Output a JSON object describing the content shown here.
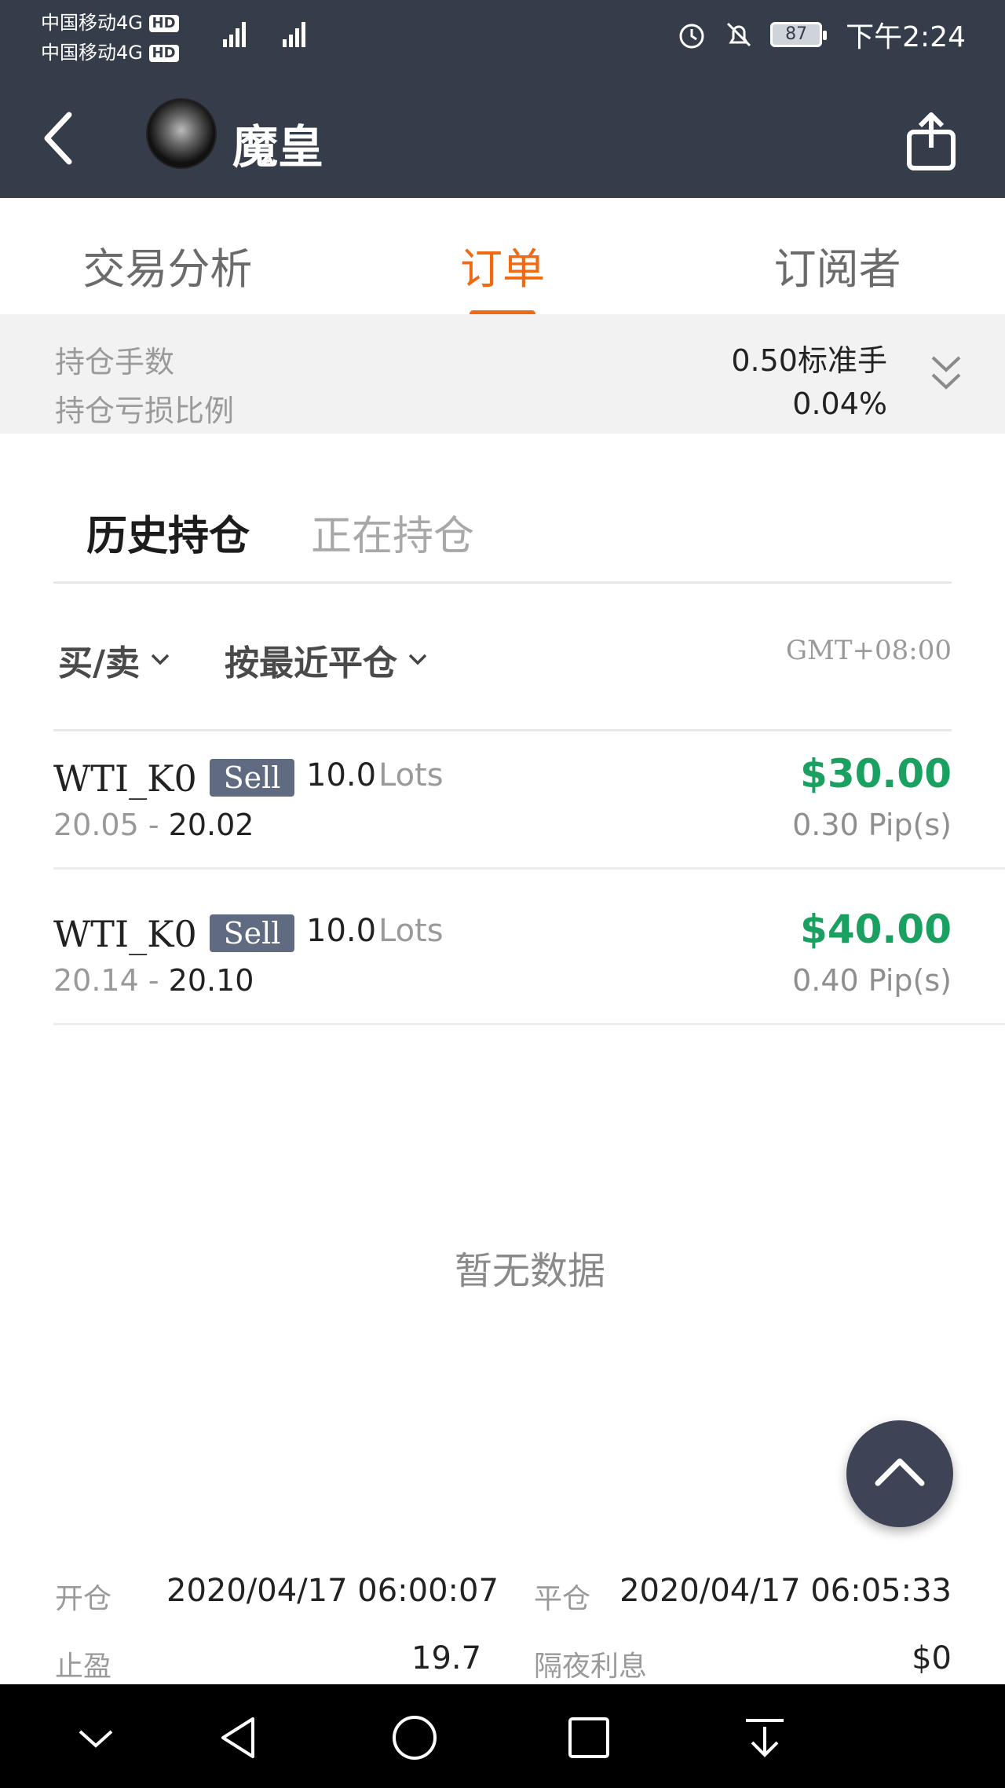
{
  "status_bar": {
    "carrier_1": "中国移动4G",
    "carrier_2": "中国移动4G",
    "hd": "HD",
    "battery": "87",
    "time": "下午2:24"
  },
  "app_bar": {
    "title": "魔皇"
  },
  "tabs": [
    {
      "label": "交易分析"
    },
    {
      "label": "订单"
    },
    {
      "label": "订阅者"
    }
  ],
  "summary": {
    "lots_label": "持仓手数",
    "lots_value": "0.50标准手",
    "ratio_label": "持仓亏损比例",
    "ratio_value": "0.04%"
  },
  "sub_tabs": [
    {
      "label": "历史持仓"
    },
    {
      "label": "正在持仓"
    }
  ],
  "filters": {
    "side": "买/卖",
    "sort": "按最近平仓",
    "timezone": "GMT+08:00"
  },
  "orders": [
    {
      "symbol": "WTI_K0",
      "side": "Sell",
      "lots": "10.0",
      "lots_unit": "Lots",
      "open": "20.05",
      "sep": " - ",
      "close": "20.02",
      "profit": "$30.00",
      "pips": "0.30 Pip(s)"
    },
    {
      "symbol": "WTI_K0",
      "side": "Sell",
      "lots": "10.0",
      "lots_unit": "Lots",
      "open": "20.14",
      "sep": " - ",
      "close": "20.10",
      "profit": "$40.00",
      "pips": "0.40 Pip(s)"
    }
  ],
  "empty_text": "暂无数据",
  "details": {
    "open_label": "开仓",
    "open_value": "2020/04/17 06:00:07",
    "close_label": "平仓",
    "close_value": "2020/04/17 06:05:33",
    "tp_label": "止盈",
    "tp_value": "19.7",
    "swap_label": "隔夜利息",
    "swap_value": "$0"
  },
  "colors": {
    "header_bg": "#353d4b",
    "accent": "#f06a14",
    "profit": "#1aa060",
    "badge": "#606a80"
  }
}
